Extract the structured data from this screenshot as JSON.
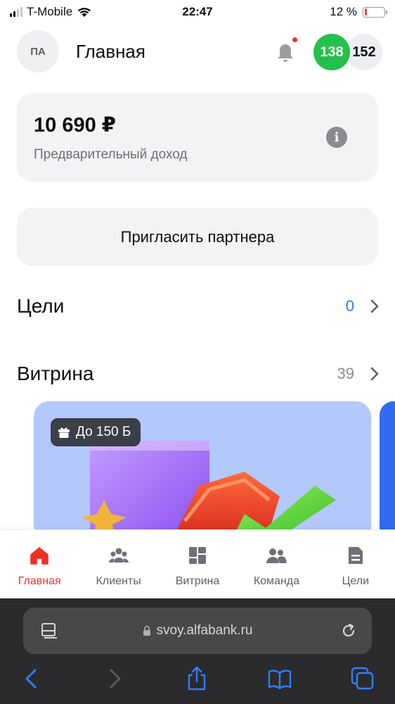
{
  "status_bar": {
    "carrier": "T-Mobile",
    "time": "22:47",
    "battery_percent": "12 %",
    "battery_level": 0.12,
    "battery_color": "#ff3b30"
  },
  "header": {
    "avatar_initials": "ПА",
    "title": "Главная",
    "badge_green": "138",
    "badge_gray": "152",
    "notification_icon": "bell-icon",
    "accent_color": "#ef3124"
  },
  "income": {
    "amount": "10 690 ₽",
    "label": "Предварительный доход",
    "info_icon": "i"
  },
  "invite": {
    "label": "Пригласить партнера"
  },
  "goals": {
    "title": "Цели",
    "count": "0",
    "count_color": "#2a7bf4"
  },
  "showcase": {
    "title": "Витрина",
    "count": "39",
    "count_color": "#8a8c91",
    "card": {
      "badge": "До 150 Б",
      "badge_icon": "gift-icon"
    }
  },
  "bottom_nav": {
    "items": [
      {
        "label": "Главная",
        "icon": "home-icon",
        "active": true
      },
      {
        "label": "Клиенты",
        "icon": "clients-icon",
        "active": false
      },
      {
        "label": "Витрина",
        "icon": "showcase-grid-icon",
        "active": false
      },
      {
        "label": "Команда",
        "icon": "team-icon",
        "active": false
      },
      {
        "label": "Цели",
        "icon": "goals-icon",
        "active": false
      }
    ]
  },
  "browser": {
    "url": "svoy.alfabank.ru"
  }
}
